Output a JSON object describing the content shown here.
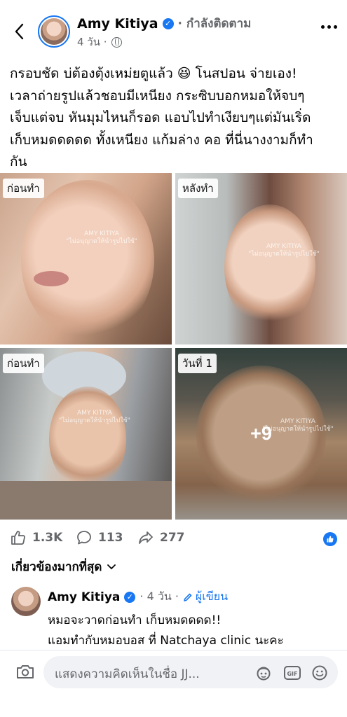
{
  "post": {
    "author": "Amy Kitiya",
    "following_label": "· กำลังติดตาม",
    "time": "4 วัน ·",
    "text_lines": [
      "กรอบชัด บ่ต้องตุ้งเหม่ยตูแล้ว 😆 โนสปอน จ่ายเอง!",
      "เวลาถ่ายรูปแล้วชอบมีเหนียง กระซิบบอกหมอให้จบๆ",
      "เจ็บแต่จบ หันมุมไหนก็รอด แอบไปทำเงียบๆแต่มันเริ่ด",
      "เก็บหมดดดดด ทั้งเหนียง แก้มล่าง คอ ที่นี่นางงามก็ทำ",
      "กัน"
    ]
  },
  "photos": [
    {
      "tag": "ก่อนทำ",
      "watermark": "AMY KITIYA\n\"ไม่อนุญาตให้นำรูปไปใช้\""
    },
    {
      "tag": "หลังทำ",
      "watermark": "AMY KITIYA\n\"ไม่อนุญาตให้นำรูปไปใช้\""
    },
    {
      "tag": "ก่อนทำ",
      "watermark": "AMY KITIYA\n\"ไม่อนุญาตให้นำรูปไปใช้\""
    },
    {
      "tag": "วันที่ 1",
      "watermark": "AMY KITIYA\n\"ไม่อนุญาตให้นำรูปไปใช้\"",
      "more": "+9"
    }
  ],
  "reactions": {
    "likes": "1.3K",
    "comments": "113",
    "shares": "277"
  },
  "relevant_label": "เกี่ยวข้องมากที่สุด",
  "comment": {
    "name": "Amy Kitiya",
    "time": "· 4 วัน ·",
    "author_label": "ผู้เขียน",
    "lines": [
      "หมอจะวาดก่อนทำ เก็บหมดดดด!!",
      "แอมทำกับหมอบอส ที่ Natchaya clinic นะคะ"
    ]
  },
  "composer": {
    "placeholder": "แสดงความคิดเห็นในชื่อ JJ..."
  },
  "colors": {
    "accent": "#1877f2",
    "secondary_text": "#65676b",
    "input_bg": "#f0f2f5"
  }
}
